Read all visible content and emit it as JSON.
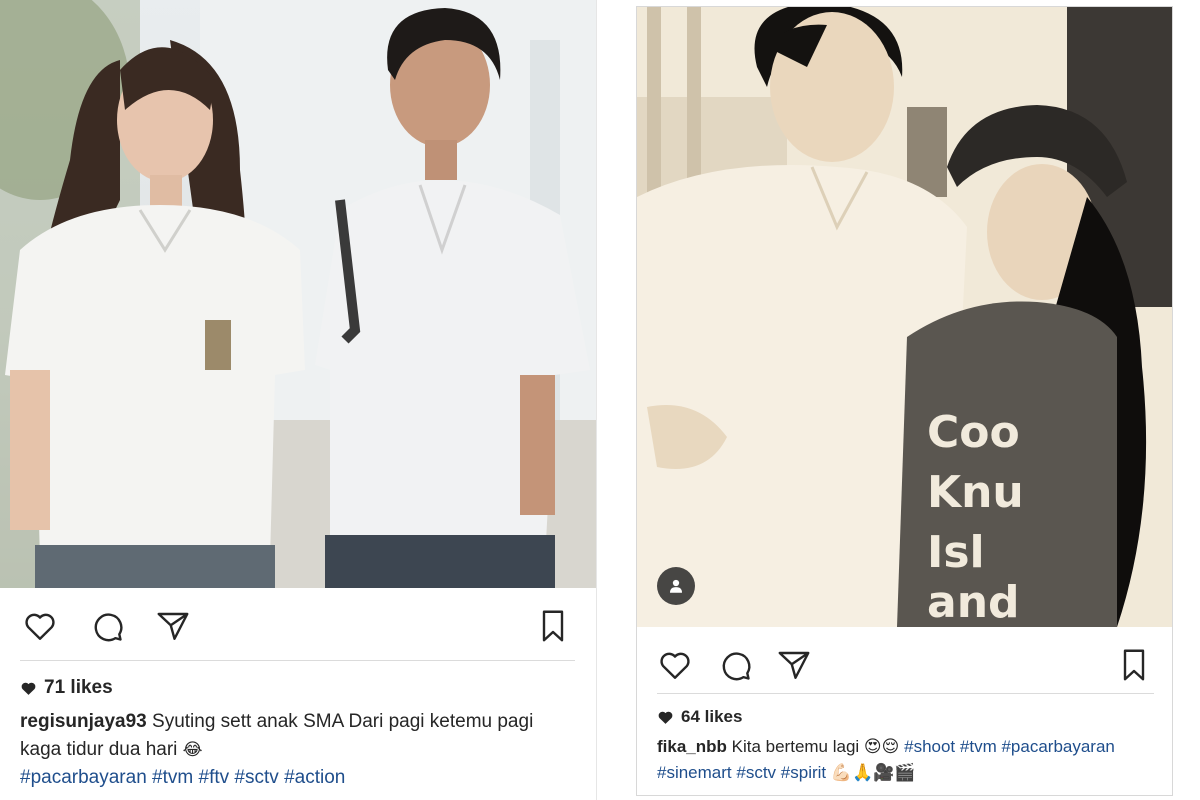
{
  "colors": {
    "text": "#262626",
    "hashtag": "#1f4e8c",
    "divider": "#dbdbdb",
    "photo_left": "#dfe3e4",
    "photo_right": "#f2ead9"
  },
  "posts": [
    {
      "photo_desc": "photo-girl-and-boy-school-uniforms",
      "actions": [
        "heart-icon",
        "comment-icon",
        "share-icon",
        "bookmark-icon"
      ],
      "likes": "71 likes",
      "username": "regisunjaya93",
      "caption_line1": " Syuting sett anak SMA Dari pagi ketemu pagi",
      "caption_line2": "kaga tidur dua hari ",
      "caption_emoji": "😂",
      "hashtags": [
        "#pacarbayaran",
        "#tvm",
        "#ftv",
        "#sctv",
        "#action"
      ]
    },
    {
      "photo_desc": "photo-sepia-boy-and-woman-cap",
      "actions": [
        "heart-icon",
        "comment-icon",
        "share-icon",
        "bookmark-icon"
      ],
      "likes": "64 likes",
      "username": "fika_nbb",
      "caption_line1": " Kita bertemu lagi ",
      "caption_emoji1": "😍😌",
      "hashtags_line1": [
        "#shoot",
        "#tvm",
        "#pacarbayaran"
      ],
      "hashtags_line2": [
        "#sinemart",
        "#sctv",
        "#spirit"
      ],
      "caption_emoji2": "💪🏻🙏🎥🎬"
    }
  ]
}
